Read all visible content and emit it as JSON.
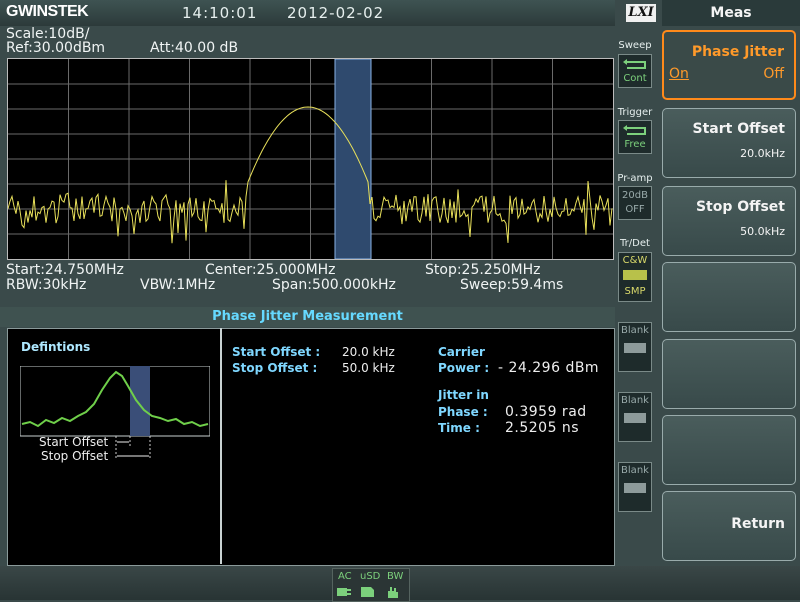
{
  "header": {
    "brand": "GWINSTEK",
    "time": "14:10:01",
    "date": "2012-02-02",
    "lxi": "LXI"
  },
  "display": {
    "scale": "Scale:10dB/",
    "ref": "Ref:30.00dBm",
    "att": "Att:40.00 dB",
    "start": "Start:24.750MHz",
    "center": "Center:25.000MHz",
    "stop": "Stop:25.250MHz",
    "rbw": "RBW:30kHz",
    "vbw": "VBW:1MHz",
    "span": "Span:500.000kHz",
    "sweep_time": "Sweep:59.4ms"
  },
  "side_status": {
    "sweep_label": "Sweep",
    "sweep_value": "Cont",
    "trigger_label": "Trigger",
    "trigger_value": "Free",
    "preamp_label": "Pr-amp",
    "preamp_value1": "20dB",
    "preamp_value2": "OFF",
    "trdet_label": "Tr/Det",
    "trdet_value1": "C&W",
    "trdet_value2": "SMP",
    "blank1": "Blank",
    "blank2": "Blank",
    "blank3": "Blank"
  },
  "measurement": {
    "title": "Phase Jitter Measurement",
    "definitions_title": "Defintions",
    "def_start": "Start Offset",
    "def_stop": "Stop Offset",
    "start_offset_label": "Start Offset :",
    "start_offset_value": "20.0  kHz",
    "stop_offset_label": "Stop Offset  :",
    "stop_offset_value": "50.0  kHz",
    "carrier_title": "Carrier",
    "power_label": "Power :",
    "power_value": "- 24.296 dBm",
    "jitter_title": "Jitter in",
    "phase_label": "Phase :",
    "phase_value": "0.3959  rad",
    "time_label": "Time   :",
    "time_value": "2.5205    ns"
  },
  "menu": {
    "title": "Meas",
    "phase_jitter": "Phase Jitter",
    "phase_on": "On",
    "phase_off": "Off",
    "start_offset": "Start Offset",
    "start_offset_value": "20.0kHz",
    "stop_offset": "Stop Offset",
    "stop_offset_value": "50.0kHz",
    "return": "Return"
  },
  "status_bar": {
    "ac": "AC",
    "usd": "uSD",
    "bw": "BW"
  },
  "colors": {
    "trace": "#e8e05a",
    "highlight_band": "#2f4a6e",
    "accent": "#ff8a1a",
    "definition_trace": "#6fcf4a"
  },
  "icons": {
    "sweep": "cycle-arrow-icon",
    "trigger": "cycle-arrow-icon",
    "ac": "plug-icon",
    "usd": "sd-card-icon",
    "bw": "hand-icon"
  }
}
